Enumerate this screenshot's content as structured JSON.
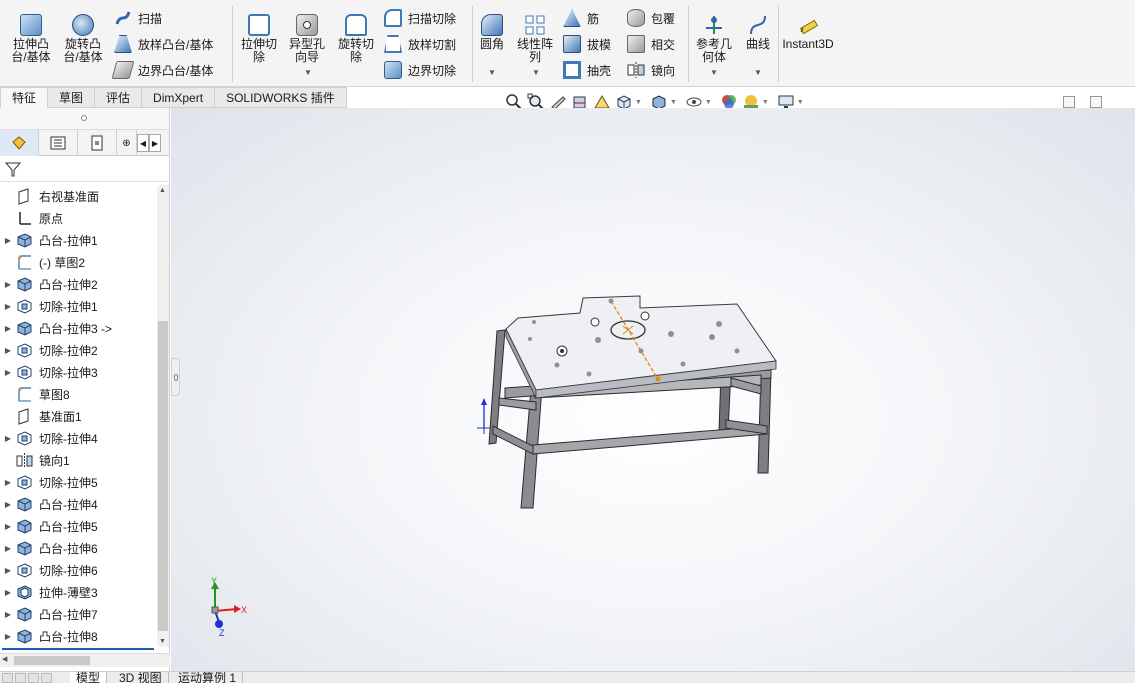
{
  "ribbon": {
    "boss_extrude": "拉伸凸\n台/基体",
    "boss_revolve": "旋转凸\n台/基体",
    "sweep": "扫描",
    "loft_boss": "放样凸台/基体",
    "boundary_boss": "边界凸台/基体",
    "cut_extrude": "拉伸切\n除",
    "hole_wizard": "异型孔\n向导",
    "cut_revolve": "旋转切\n除",
    "swept_cut": "扫描切除",
    "lofted_cut": "放样切割",
    "boundary_cut": "边界切除",
    "fillet": "圆角",
    "linear_pattern": "线性阵\n列",
    "rib": "筋",
    "draft": "拔模",
    "shell": "抽壳",
    "wrap": "包覆",
    "intersect": "相交",
    "mirror": "镜向",
    "ref_geometry": "参考几\n何体",
    "curves": "曲线",
    "instant3d": "Instant3D"
  },
  "tabs": [
    "特征",
    "草图",
    "评估",
    "DimXpert",
    "SOLIDWORKS 插件"
  ],
  "tree": [
    {
      "label": "右视基准面",
      "expand": false,
      "icon": "plane-icon"
    },
    {
      "label": "原点",
      "expand": false,
      "icon": "origin-icon"
    },
    {
      "label": "凸台-拉伸1",
      "expand": true,
      "icon": "boss-extrude-icon"
    },
    {
      "label": "(-) 草图2",
      "expand": false,
      "icon": "sketch-icon"
    },
    {
      "label": "凸台-拉伸2",
      "expand": true,
      "icon": "boss-extrude-icon"
    },
    {
      "label": "切除-拉伸1",
      "expand": true,
      "icon": "cut-extrude-icon"
    },
    {
      "label": "凸台-拉伸3 ->",
      "expand": true,
      "icon": "boss-extrude-icon"
    },
    {
      "label": "切除-拉伸2",
      "expand": true,
      "icon": "cut-extrude-icon"
    },
    {
      "label": "切除-拉伸3",
      "expand": true,
      "icon": "cut-extrude-icon"
    },
    {
      "label": "草图8",
      "expand": false,
      "icon": "sketch-icon"
    },
    {
      "label": "基准面1",
      "expand": false,
      "icon": "plane-icon"
    },
    {
      "label": "切除-拉伸4",
      "expand": true,
      "icon": "cut-extrude-icon"
    },
    {
      "label": "镜向1",
      "expand": false,
      "icon": "mirror-icon"
    },
    {
      "label": "切除-拉伸5",
      "expand": true,
      "icon": "cut-extrude-icon"
    },
    {
      "label": "凸台-拉伸4",
      "expand": true,
      "icon": "boss-extrude-icon"
    },
    {
      "label": "凸台-拉伸5",
      "expand": true,
      "icon": "boss-extrude-icon"
    },
    {
      "label": "凸台-拉伸6",
      "expand": true,
      "icon": "boss-extrude-icon"
    },
    {
      "label": "切除-拉伸6",
      "expand": true,
      "icon": "cut-extrude-icon"
    },
    {
      "label": "拉伸-薄壁3",
      "expand": true,
      "icon": "thin-extrude-icon"
    },
    {
      "label": "凸台-拉伸7",
      "expand": true,
      "icon": "boss-extrude-icon"
    },
    {
      "label": "凸台-拉伸8",
      "expand": true,
      "icon": "boss-extrude-icon"
    }
  ],
  "bottom_tabs": [
    "模型",
    "3D 视图",
    "运动算例 1"
  ],
  "triad": {
    "x": "X",
    "y": "Y",
    "z": "Z"
  },
  "colors": {
    "accent": "#1f5fb3",
    "axis_x": "#e02020",
    "axis_y": "#1a9a1a",
    "axis_z": "#2030d0",
    "model": "#c9ccd2"
  }
}
